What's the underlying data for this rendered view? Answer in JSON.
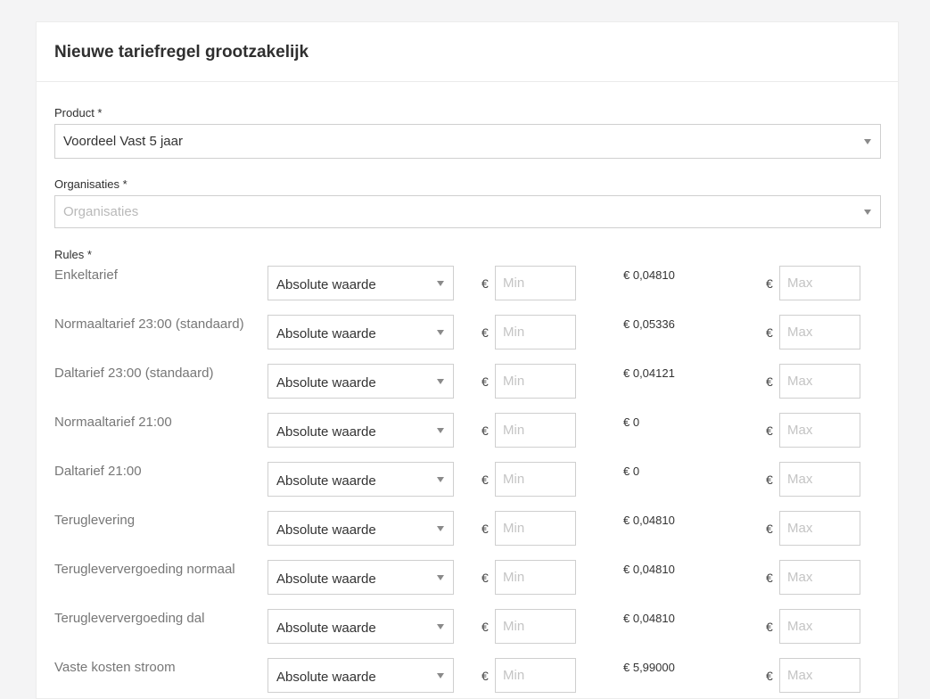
{
  "card": {
    "title": "Nieuwe tariefregel grootzakelijk"
  },
  "product": {
    "label": "Product *",
    "value": "Voordeel Vast 5 jaar"
  },
  "organisaties": {
    "label": "Organisaties *",
    "placeholder": "Organisaties"
  },
  "rules": {
    "label": "Rules *",
    "currency_symbol": "€",
    "min_placeholder": "Min",
    "max_placeholder": "Max",
    "items": [
      {
        "name": "Enkeltarief",
        "type": "Absolute waarde",
        "current": "€ 0,04810"
      },
      {
        "name": "Normaaltarief 23:00 (standaard)",
        "type": "Absolute waarde",
        "current": "€ 0,05336"
      },
      {
        "name": "Daltarief 23:00 (standaard)",
        "type": "Absolute waarde",
        "current": "€ 0,04121"
      },
      {
        "name": "Normaaltarief 21:00",
        "type": "Absolute waarde",
        "current": "€ 0"
      },
      {
        "name": "Daltarief 21:00",
        "type": "Absolute waarde",
        "current": "€ 0"
      },
      {
        "name": "Teruglevering",
        "type": "Absolute waarde",
        "current": "€ 0,04810"
      },
      {
        "name": "Terugleververgoeding normaal",
        "type": "Absolute waarde",
        "current": "€ 0,04810"
      },
      {
        "name": "Terugleververgoeding dal",
        "type": "Absolute waarde",
        "current": "€ 0,04810"
      },
      {
        "name": "Vaste kosten stroom",
        "type": "Absolute waarde",
        "current": "€ 5,99000"
      }
    ]
  }
}
